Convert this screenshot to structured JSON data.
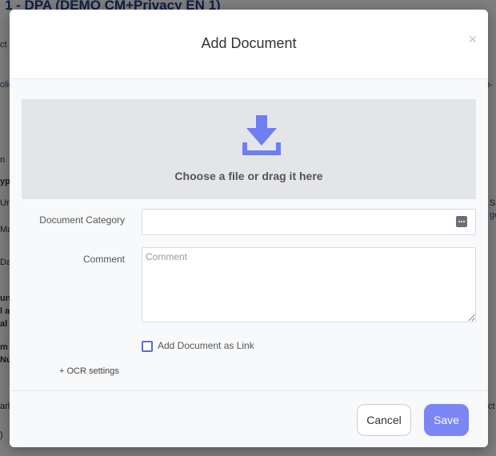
{
  "background": {
    "title": "1 - DPA (DEMO CM+Privacy EN 1)",
    "fragments": [
      "ct",
      "olig",
      "on-",
      "n",
      "yp",
      "Un",
      "Ma",
      "Da",
      "un",
      "l a",
      "al",
      "m",
      "Nu",
      "arl",
      "S",
      "ge",
      "ct",
      ")"
    ]
  },
  "modal": {
    "title": "Add Document",
    "close_icon": "×",
    "dropzone": {
      "icon": "download-icon",
      "text": "Choose a file or drag it here",
      "icon_color": "#6f7ef0"
    },
    "fields": {
      "category_label": "Document Category",
      "category_value": "",
      "comment_label": "Comment",
      "comment_placeholder": "Comment",
      "link_checkbox_label": "Add Document as Link",
      "link_checkbox_checked": false
    },
    "ocr_settings": "+ OCR settings",
    "footer": {
      "cancel_label": "Cancel",
      "save_label": "Save"
    }
  },
  "colors": {
    "accent": "#7b86f5",
    "overlay": "rgba(0,0,0,0.5)"
  }
}
